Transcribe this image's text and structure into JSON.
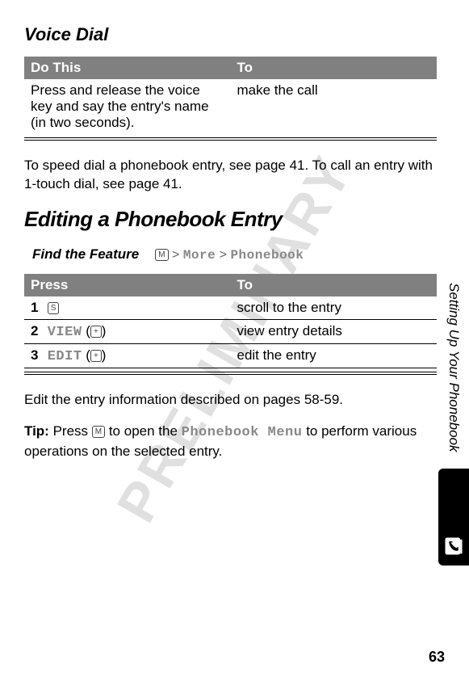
{
  "watermark": "PRELIMINARY",
  "section_title": "Voice Dial",
  "table1": {
    "header1": "Do This",
    "header2": "To",
    "row1_col1": "Press and release the voice key and say the entry's name (in two seconds).",
    "row1_col2": "make the call"
  },
  "para1": "To speed dial a phonebook entry, see page 41. To call an entry with 1-touch dial, see page 41.",
  "heading_editing": "Editing a Phonebook Entry",
  "find_feature_label": "Find the Feature",
  "find_feature": {
    "glyph": "M",
    "sep1": " > ",
    "item1": "More",
    "sep2": " > ",
    "item2": "Phonebook"
  },
  "table2": {
    "header1": "Press",
    "header2": "To",
    "rows": [
      {
        "num": "1",
        "press_glyph": "S",
        "press_label": "",
        "to": "scroll to the entry"
      },
      {
        "num": "2",
        "press_glyph": "+",
        "press_label": "VIEW",
        "to": "view entry details"
      },
      {
        "num": "3",
        "press_glyph": "+",
        "press_label": "EDIT",
        "to": "edit the entry"
      }
    ]
  },
  "para2": "Edit the entry information described on pages 58-59.",
  "tip_label": "Tip:",
  "tip_part1": " Press ",
  "tip_glyph": "M",
  "tip_part2": " to open the ",
  "tip_menu_text": "Phonebook Menu",
  "tip_part3": " to perform various operations on the selected entry.",
  "side_text": "Setting Up Your Phonebook",
  "page_number": "63"
}
